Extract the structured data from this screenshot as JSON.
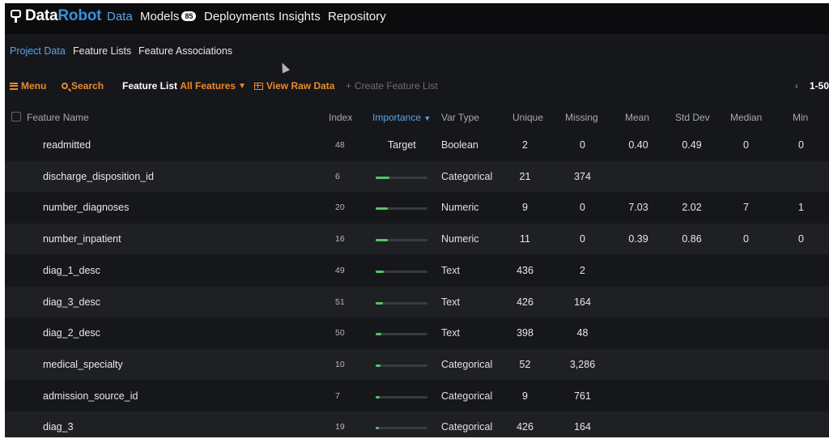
{
  "nav": {
    "logo_part1": "Data",
    "logo_part2": "Robot",
    "items": [
      {
        "label": "Data",
        "active": true
      },
      {
        "label": "Models",
        "badge": "85"
      },
      {
        "label": "Deployments"
      },
      {
        "label": "Insights"
      },
      {
        "label": "Repository"
      }
    ]
  },
  "subnav": {
    "items": [
      {
        "label": "Project Data",
        "active": true
      },
      {
        "label": "Feature Lists"
      },
      {
        "label": "Feature Associations"
      }
    ]
  },
  "toolbar": {
    "menu": "Menu",
    "search": "Search",
    "feature_list_label": "Feature List",
    "feature_list_value": "All Features",
    "view_raw": "View Raw Data",
    "create_list": "Create Feature List",
    "pager_prev": "‹",
    "pager": "1-50"
  },
  "table": {
    "headers": {
      "name": "Feature Name",
      "index": "Index",
      "importance": "Importance",
      "var_type": "Var Type",
      "unique": "Unique",
      "missing": "Missing",
      "mean": "Mean",
      "std": "Std Dev",
      "median": "Median",
      "min": "Min"
    },
    "rows": [
      {
        "name": "readmitted",
        "index": "48",
        "importance_label": "Target",
        "importance": null,
        "var_type": "Boolean",
        "unique": "2",
        "missing": "0",
        "mean": "0.40",
        "std": "0.49",
        "median": "0",
        "min": "0"
      },
      {
        "name": "discharge_disposition_id",
        "index": "6",
        "importance_label": "",
        "importance": 0.26,
        "var_type": "Categorical",
        "unique": "21",
        "missing": "374",
        "mean": "",
        "std": "",
        "median": "",
        "min": ""
      },
      {
        "name": "number_diagnoses",
        "index": "20",
        "importance_label": "",
        "importance": 0.24,
        "var_type": "Numeric",
        "unique": "9",
        "missing": "0",
        "mean": "7.03",
        "std": "2.02",
        "median": "7",
        "min": "1"
      },
      {
        "name": "number_inpatient",
        "index": "16",
        "importance_label": "",
        "importance": 0.23,
        "var_type": "Numeric",
        "unique": "11",
        "missing": "0",
        "mean": "0.39",
        "std": "0.86",
        "median": "0",
        "min": "0"
      },
      {
        "name": "diag_1_desc",
        "index": "49",
        "importance_label": "",
        "importance": 0.15,
        "var_type": "Text",
        "unique": "436",
        "missing": "2",
        "mean": "",
        "std": "",
        "median": "",
        "min": ""
      },
      {
        "name": "diag_3_desc",
        "index": "51",
        "importance_label": "",
        "importance": 0.14,
        "var_type": "Text",
        "unique": "426",
        "missing": "164",
        "mean": "",
        "std": "",
        "median": "",
        "min": ""
      },
      {
        "name": "diag_2_desc",
        "index": "50",
        "importance_label": "",
        "importance": 0.11,
        "var_type": "Text",
        "unique": "398",
        "missing": "48",
        "mean": "",
        "std": "",
        "median": "",
        "min": ""
      },
      {
        "name": "medical_specialty",
        "index": "10",
        "importance_label": "",
        "importance": 0.09,
        "var_type": "Categorical",
        "unique": "52",
        "missing": "3,286",
        "mean": "",
        "std": "",
        "median": "",
        "min": ""
      },
      {
        "name": "admission_source_id",
        "index": "7",
        "importance_label": "",
        "importance": 0.08,
        "var_type": "Categorical",
        "unique": "9",
        "missing": "761",
        "mean": "",
        "std": "",
        "median": "",
        "min": ""
      },
      {
        "name": "diag_3",
        "index": "19",
        "importance_label": "",
        "importance": 0.07,
        "var_type": "Categorical",
        "unique": "426",
        "missing": "164",
        "mean": "",
        "std": "",
        "median": "",
        "min": ""
      }
    ]
  },
  "colors": {
    "accent_orange": "#e98a2c",
    "accent_blue": "#5aa6e8",
    "importance_green": "#56c46a"
  }
}
